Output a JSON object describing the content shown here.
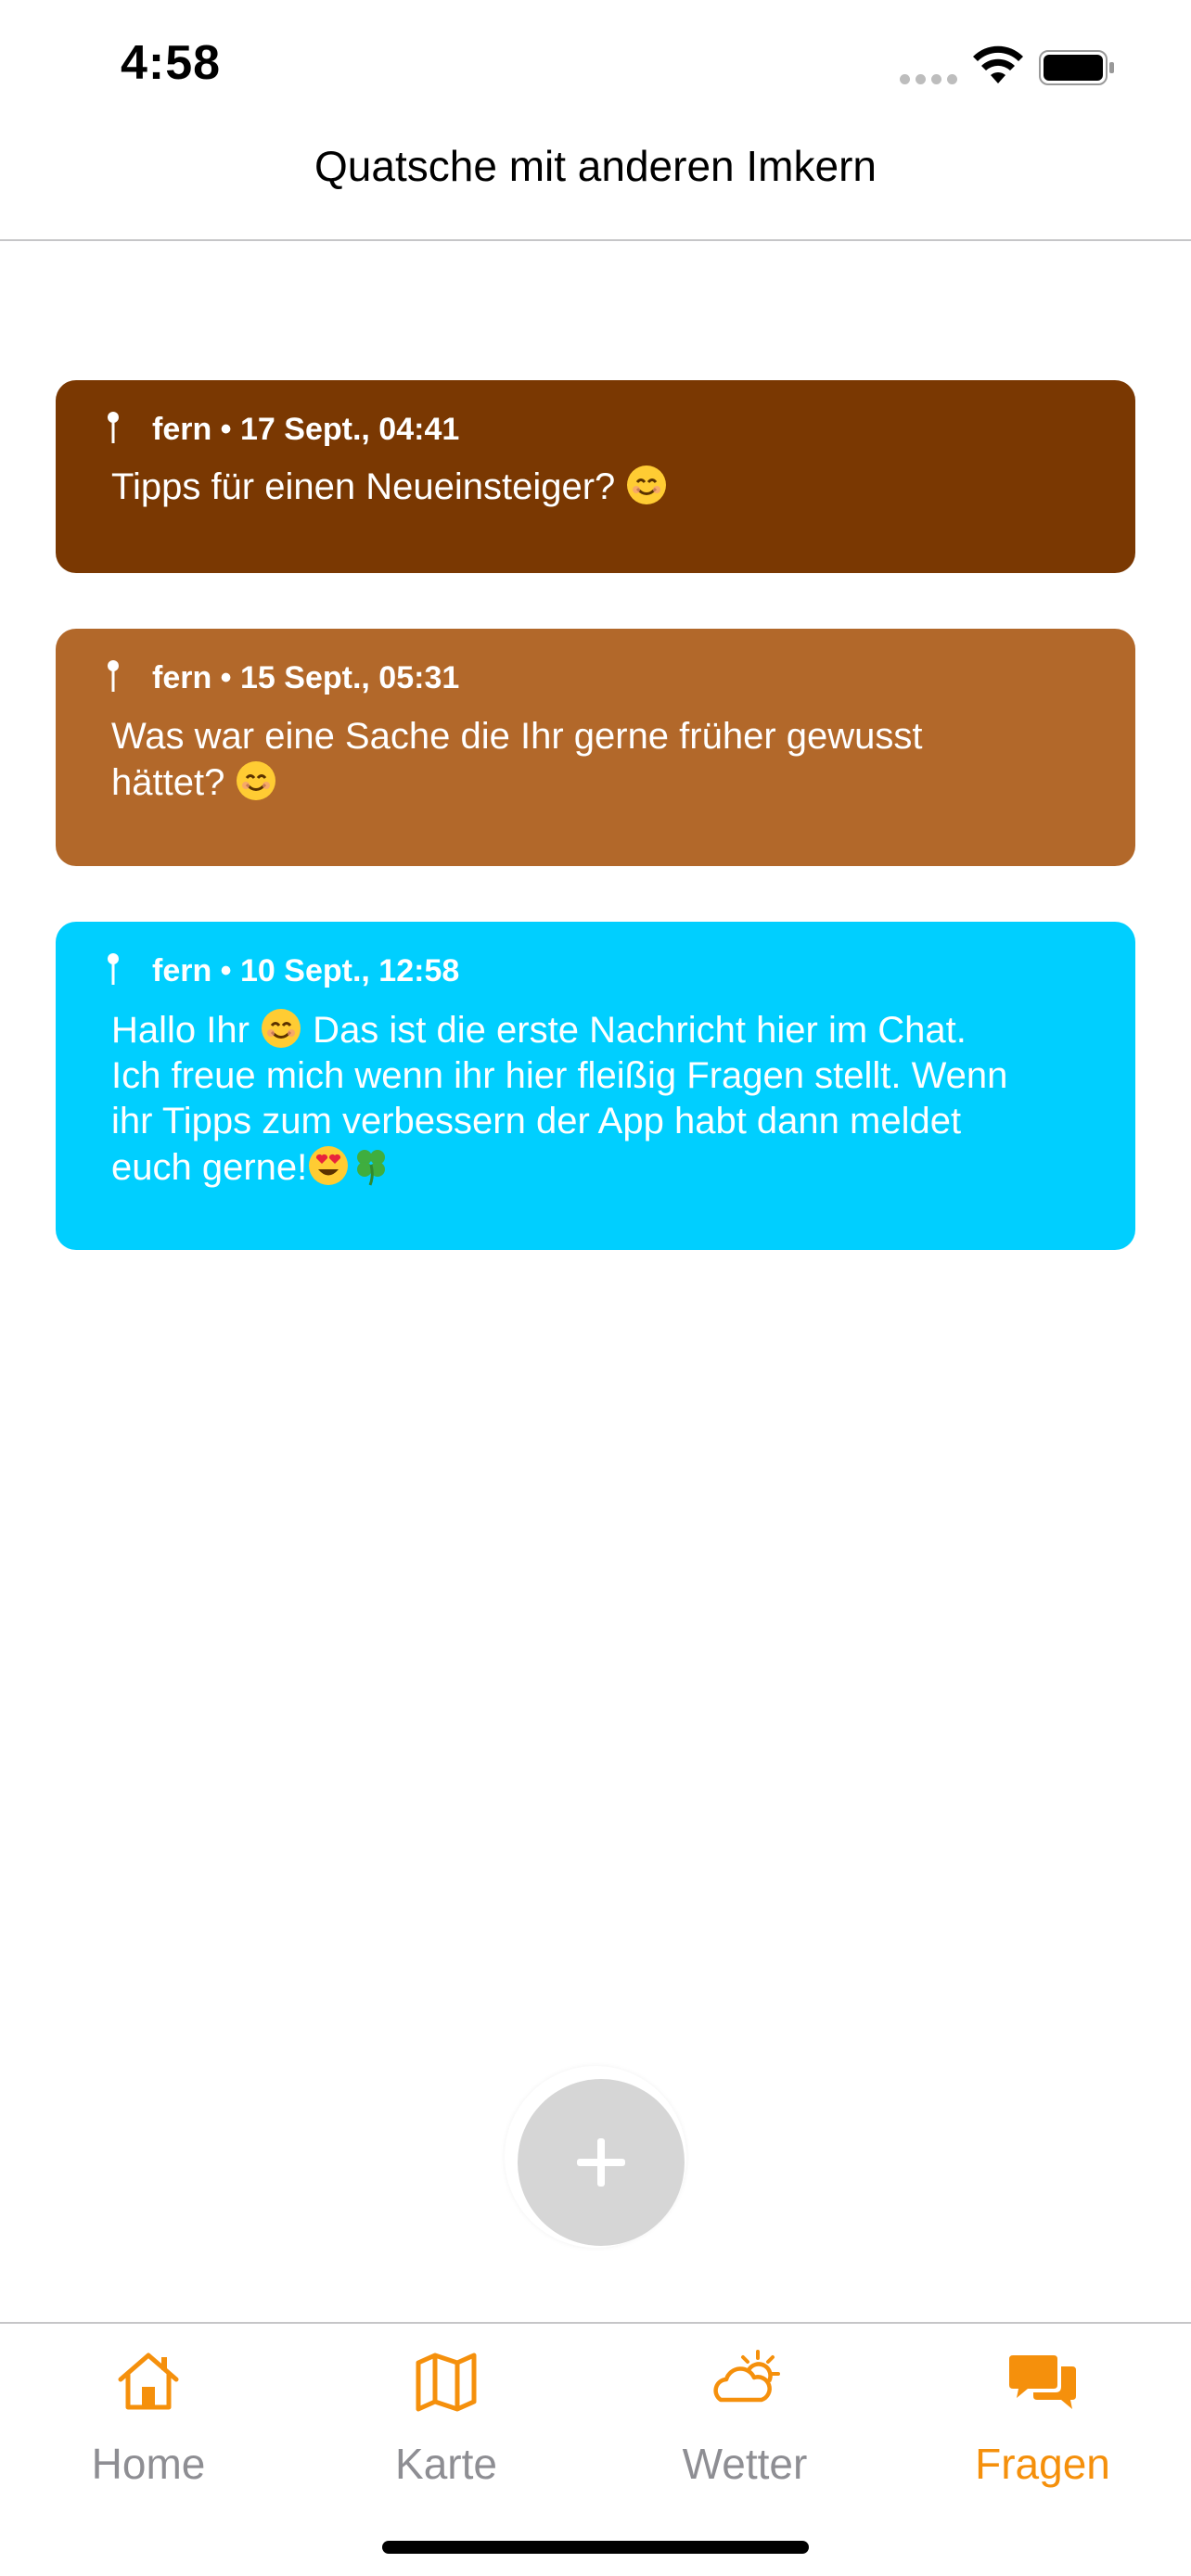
{
  "status_bar": {
    "time": "4:58"
  },
  "header": {
    "title": "Quatsche mit anderen Imkern"
  },
  "messages": [
    {
      "meta": "fern • 17 Sept., 04:41",
      "text_parts": [
        "Tipps für einen Neueinsteiger? "
      ],
      "color": "#7a3802"
    },
    {
      "meta": "fern • 15 Sept., 05:31",
      "line1": "Was war eine Sache die Ihr gerne früher gewusst",
      "line2": "hättet? ",
      "color": "#b2682a"
    },
    {
      "meta": "fern • 10 Sept., 12:58",
      "line1_a": "Hallo Ihr ",
      "line1_b": " Das ist die erste Nachricht hier im Chat.",
      "line2": "Ich freue mich wenn ihr hier fleißig Fragen stellt. Wenn",
      "line3": "ihr Tipps zum verbessern der App habt dann meldet",
      "line4": "euch gerne!",
      "color": "#00cfff"
    }
  ],
  "add_button": {
    "icon": "plus-icon"
  },
  "tabs": [
    {
      "label": "Home",
      "icon": "house-icon",
      "active": false
    },
    {
      "label": "Karte",
      "icon": "map-icon",
      "active": false
    },
    {
      "label": "Wetter",
      "icon": "cloud-sun-icon",
      "active": false
    },
    {
      "label": "Fragen",
      "icon": "chat-bubbles-icon",
      "active": true
    }
  ],
  "colors": {
    "accent": "#f5900c",
    "inactive_tab": "#8e8e93",
    "message_1": "#7a3802",
    "message_2": "#b2682a",
    "message_3": "#00cfff",
    "add_button": "#d6d6d6"
  }
}
